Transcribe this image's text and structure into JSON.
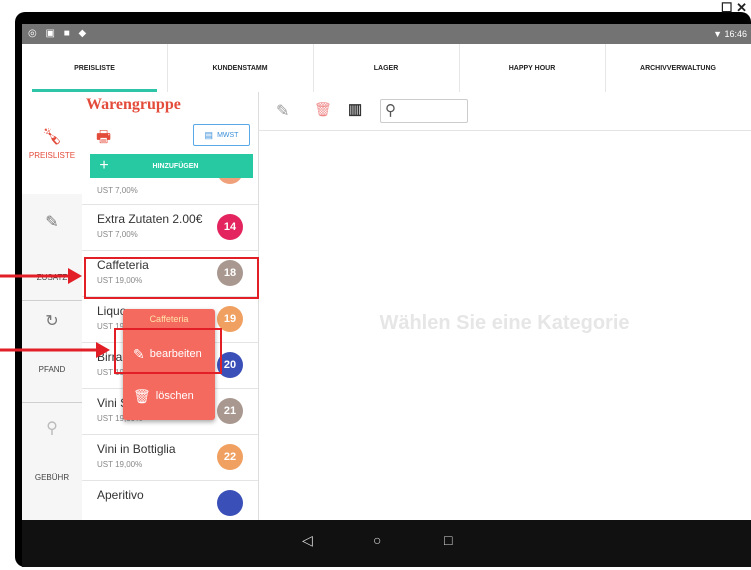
{
  "window": {
    "corner_icons": "☐ ✕"
  },
  "statusbar": {
    "left_icons": "◎ ▣ ■ ◆",
    "right_text": "▼ 16:46"
  },
  "tabs": [
    {
      "label": "PREISLISTE",
      "active": true
    },
    {
      "label": "KUNDENSTAMM",
      "active": false
    },
    {
      "label": "LAGER",
      "active": false
    },
    {
      "label": "HAPPY HOUR",
      "active": false
    },
    {
      "label": "ARCHIVVERWALTUNG",
      "active": false
    }
  ],
  "rail": {
    "preisliste": "PREISLISTE",
    "zusatz": "ZUSATZ",
    "pfand": "PFAND",
    "gebuehr": "GEBÜHR"
  },
  "listpanel": {
    "title": "Warengruppe",
    "mwst_button": "MWST",
    "add_button": "HINZUFÜGEN"
  },
  "items": [
    {
      "name": "",
      "sub": "UST 7,00%",
      "badge": "",
      "color": "#f0a07a"
    },
    {
      "name": "Extra Zutaten 2.00€",
      "sub": "UST 7,00%",
      "badge": "14",
      "color": "#e3245f"
    },
    {
      "name": "Caffeteria",
      "sub": "UST 19,00%",
      "badge": "18",
      "color": "#a99890"
    },
    {
      "name": "Liquo",
      "sub": "UST 19,00%",
      "badge": "19",
      "color": "#f0a060"
    },
    {
      "name": "Birra",
      "sub": "UST 19",
      "badge": "20",
      "color": "#3a4fb8"
    },
    {
      "name": "Vini S",
      "sub": "UST 19,00%",
      "badge": "21",
      "color": "#a99890"
    },
    {
      "name": "Vini in Bottiglia",
      "sub": "UST 19,00%",
      "badge": "22",
      "color": "#f0a060"
    },
    {
      "name": "Aperitivo",
      "sub": "",
      "badge": "",
      "color": "#3a4fb8"
    }
  ],
  "popup": {
    "title": "Caffeteria",
    "edit": "bearbeiten",
    "delete": "löschen"
  },
  "main": {
    "empty_message": "Wählen Sie eine Kategorie"
  },
  "navbar": {
    "back": "◁",
    "home": "○",
    "recents": "□"
  }
}
